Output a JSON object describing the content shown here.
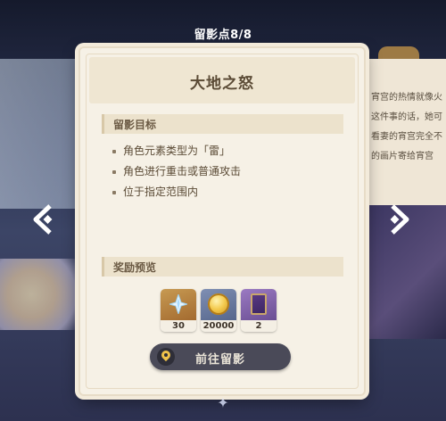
{
  "header": {
    "title": "留影点8/8"
  },
  "card": {
    "title": "大地之怒",
    "objectives_label": "留影目标",
    "objectives": [
      "角色元素类型为「雷」",
      "角色进行重击或普通攻击",
      "位于指定范围内"
    ],
    "rewards_label": "奖励预览",
    "rewards": [
      {
        "item": "primogem",
        "qty": "30"
      },
      {
        "item": "mora-coin",
        "qty": "20000"
      },
      {
        "item": "hero-wit-book",
        "qty": "2"
      }
    ],
    "action_label": "前往留影"
  },
  "background": {
    "story_text": [
      "宵宫的热情就像火",
      "这件事的话，她可",
      "看妻的宵宫完全不",
      "的画片寄给宵宫"
    ]
  },
  "colors": {
    "card_bg": "#f6f1e6",
    "button_bg": "#4a4a58",
    "accent": "#f0c24a"
  }
}
